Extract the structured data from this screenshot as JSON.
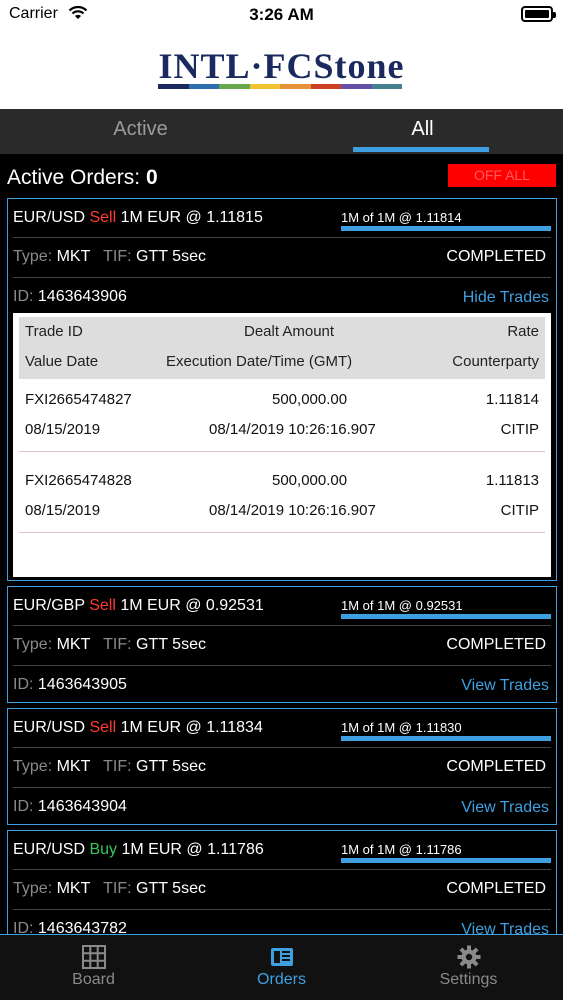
{
  "status_bar": {
    "carrier": "Carrier",
    "time": "3:26 AM"
  },
  "header": {
    "logo_text": "INTL·FCStone"
  },
  "tabs": {
    "active": "Active",
    "all": "All"
  },
  "active_orders": {
    "label": "Active Orders:",
    "count": "0",
    "off_all": "OFF ALL"
  },
  "orders": [
    {
      "pair": "EUR/USD",
      "side": "Sell",
      "details": "1M EUR @ 1.11815",
      "fill": "1M of 1M @ 1.11814",
      "type_label": "Type:",
      "type": "MKT",
      "tif_label": "TIF:",
      "tif": "GTT 5sec",
      "status": "COMPLETED",
      "id_label": "ID:",
      "id": "1463643906",
      "trades_link": "Hide Trades"
    },
    {
      "pair": "EUR/GBP",
      "side": "Sell",
      "details": "1M EUR @ 0.92531",
      "fill": "1M of 1M @ 0.92531",
      "type_label": "Type:",
      "type": "MKT",
      "tif_label": "TIF:",
      "tif": "GTT 5sec",
      "status": "COMPLETED",
      "id_label": "ID:",
      "id": "1463643905",
      "trades_link": "View Trades"
    },
    {
      "pair": "EUR/USD",
      "side": "Sell",
      "details": "1M EUR @ 1.11834",
      "fill": "1M of 1M @ 1.11830",
      "type_label": "Type:",
      "type": "MKT",
      "tif_label": "TIF:",
      "tif": "GTT 5sec",
      "status": "COMPLETED",
      "id_label": "ID:",
      "id": "1463643904",
      "trades_link": "View Trades"
    },
    {
      "pair": "EUR/USD",
      "side": "Buy",
      "details": "1M EUR @ 1.11786",
      "fill": "1M of 1M @ 1.11786",
      "type_label": "Type:",
      "type": "MKT",
      "tif_label": "TIF:",
      "tif": "GTT 5sec",
      "status": "COMPLETED",
      "id_label": "ID:",
      "id": "1463643782",
      "trades_link": "View Trades"
    }
  ],
  "trades_table": {
    "headers": {
      "trade_id": "Trade ID",
      "dealt_amount": "Dealt Amount",
      "rate": "Rate",
      "value_date": "Value Date",
      "exec_time": "Execution Date/Time (GMT)",
      "counterparty": "Counterparty"
    },
    "rows": [
      {
        "trade_id": "FXI2665474827",
        "dealt_amount": "500,000.00",
        "rate": "1.11814",
        "value_date": "08/15/2019",
        "exec_time": "08/14/2019 10:26:16.907",
        "counterparty": "CITIP"
      },
      {
        "trade_id": "FXI2665474828",
        "dealt_amount": "500,000.00",
        "rate": "1.11813",
        "value_date": "08/15/2019",
        "exec_time": "08/14/2019 10:26:16.907",
        "counterparty": "CITIP"
      }
    ]
  },
  "tabbar": {
    "board": "Board",
    "orders": "Orders",
    "settings": "Settings"
  },
  "colors": {
    "accent": "#3ea0e0",
    "sell": "#ff3b30",
    "buy": "#34c759",
    "off_all_bg": "#ff0000"
  },
  "icons": {
    "wifi": "wifi-icon",
    "battery": "battery-icon",
    "board": "grid-icon",
    "orders": "book-icon",
    "settings": "gear-icon"
  }
}
